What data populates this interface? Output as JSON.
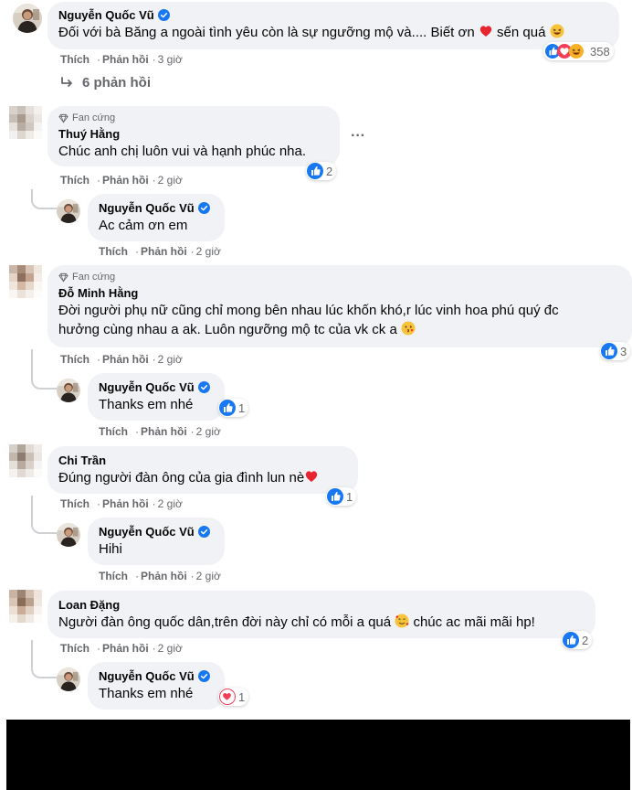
{
  "top_comment": {
    "author": "Nguyễn Quốc Vũ",
    "text_before": "Đối với bà Băng a ngoài tình yêu còn là sự ngưỡng mộ và.... Biết ơn",
    "text_after": "sến quá",
    "like": "Thích",
    "reply": "Phản hồi",
    "time": "3 giờ",
    "reaction_count": "358",
    "replies_link": "6 phản hồi"
  },
  "replies": [
    {
      "badge": "Fan cứng",
      "author": "Thuý Hằng",
      "text": "Chúc anh chị luôn vui và hạnh phúc nha.",
      "like": "Thích",
      "reply": "Phản hồi",
      "time": "2 giờ",
      "reaction_count": "2",
      "more": "···",
      "sub": {
        "author": "Nguyễn Quốc Vũ",
        "text": "Ac cảm ơn em",
        "like": "Thích",
        "reply": "Phản hồi",
        "time": "2 giờ"
      }
    },
    {
      "badge": "Fan cứng",
      "author": "Đỗ Minh Hằng",
      "text_line1": "Đời người phụ nữ cũng chỉ mong bên nhau lúc khốn khó,r lúc vinh hoa phú quý đc",
      "text_line2": "hưởng cùng nhau a ak. Luôn ngưỡng mộ tc của vk ck a",
      "like": "Thích",
      "reply": "Phản hồi",
      "time": "2 giờ",
      "reaction_count": "3",
      "sub": {
        "author": "Nguyễn Quốc Vũ",
        "text": "Thanks em nhé",
        "reaction_count": "1",
        "like": "Thích",
        "reply": "Phản hồi",
        "time": "2 giờ"
      }
    },
    {
      "author": "Chi Trần",
      "text": "Đúng người đàn ông của gia đình lun nè",
      "like": "Thích",
      "reply": "Phản hồi",
      "time": "2 giờ",
      "reaction_count": "1",
      "sub": {
        "author": "Nguyễn Quốc Vũ",
        "text": "Hihi",
        "like": "Thích",
        "reply": "Phản hồi",
        "time": "2 giờ"
      }
    },
    {
      "author": "Loan Đặng",
      "text_before": "Người đàn ông quốc dân,trên đời này chỉ có mỗi a quá",
      "text_after": "chúc ac mãi mãi hp!",
      "like": "Thích",
      "reply": "Phản hồi",
      "time": "2 giờ",
      "reaction_count": "2",
      "sub": {
        "author": "Nguyễn Quốc Vũ",
        "text": "Thanks em nhé",
        "reaction_count": "1"
      }
    }
  ],
  "colors": {
    "bubble": "#f0f2f5",
    "secondary_text": "#65676b",
    "like_blue": "#1877f2",
    "heart_red": "#f33e58"
  }
}
